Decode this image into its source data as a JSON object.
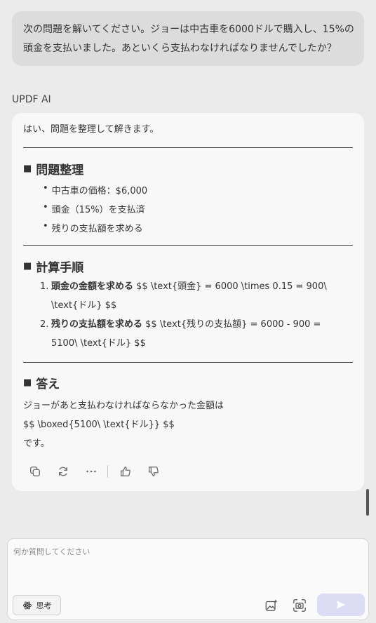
{
  "user_message": {
    "line1": "次の問題を解いてください。ジョーは中古車を6000ドルで購入し、15%の",
    "line2": "頭金を支払いました。あといくら支払わなければなりませんでしたか？"
  },
  "assistant": {
    "name": "UPDF AI",
    "intro": "はい、問題を整理して解きます。",
    "section1": {
      "title": "問題整理",
      "bullets": [
        "中古車の価格：$6,000",
        "頭金（15%）を支払済",
        "残りの支払額を求める"
      ]
    },
    "section2": {
      "title": "計算手順",
      "steps": [
        {
          "num": "1.",
          "bold": "頭金の金額を求める",
          "text_line1": " $$ \\text{頭金} = 6000 \\times 0.15 = 900\\",
          "text_line2": "\\text{ドル} $$"
        },
        {
          "num": "2.",
          "bold": "残りの支払額を求める",
          "text_line1": " $$ \\text{残りの支払額} = 6000 - 900 =",
          "text_line2": "5100\\ \\text{ドル} $$"
        }
      ]
    },
    "section3": {
      "title": "答え",
      "line1": "ジョーがあと支払わなければならなかった金額は",
      "line2": "$$ \\boxed{5100\\ \\text{ドル}} $$",
      "line3": "です。"
    }
  },
  "input": {
    "placeholder": "何か質問してください",
    "think_label": "思考"
  },
  "colors": {
    "background": "#ebebeb",
    "user_bubble": "#dcdcdc",
    "card": "#f8f8f8",
    "send_button": "#dcdcf5"
  }
}
